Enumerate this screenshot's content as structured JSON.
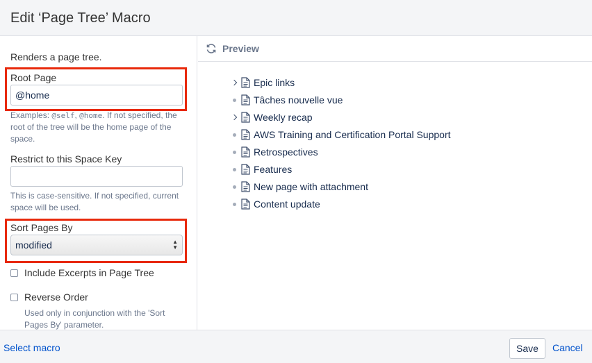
{
  "dialog": {
    "title": "Edit ‘Page Tree’ Macro"
  },
  "form": {
    "description": "Renders a page tree.",
    "root_page": {
      "label": "Root Page",
      "value": "@home",
      "help_prefix": "Examples: ",
      "help_code1": "@self",
      "help_sep": ", ",
      "help_code2": "@home",
      "help_suffix": ". If not specified, the root of the tree will be the home page of the space."
    },
    "space_key": {
      "label": "Restrict to this Space Key",
      "value": "",
      "help": "This is case-sensitive. If not specified, current space will be used."
    },
    "sort": {
      "label": "Sort Pages By",
      "selected": "modified",
      "arrow_up": "▲",
      "arrow_down": "▼"
    },
    "excerpts": {
      "label": "Include Excerpts in Page Tree",
      "checked": false
    },
    "reverse": {
      "label": "Reverse Order",
      "checked": false,
      "help": "Used only in conjunction with the 'Sort Pages By' parameter."
    }
  },
  "preview": {
    "title": "Preview",
    "items": [
      {
        "label": "Epic links",
        "expandable": true
      },
      {
        "label": "Tâches nouvelle vue",
        "expandable": false
      },
      {
        "label": "Weekly recap",
        "expandable": true
      },
      {
        "label": "AWS Training and Certification Portal Support",
        "expandable": false
      },
      {
        "label": "Retrospectives",
        "expandable": false
      },
      {
        "label": "Features",
        "expandable": false
      },
      {
        "label": "New page with attachment",
        "expandable": false
      },
      {
        "label": "Content update",
        "expandable": false
      }
    ]
  },
  "footer": {
    "select_macro": "Select macro",
    "save": "Save",
    "cancel": "Cancel"
  },
  "colors": {
    "highlight": "#e8290b",
    "link": "#0052cc",
    "header_bg": "#f4f5f7"
  }
}
